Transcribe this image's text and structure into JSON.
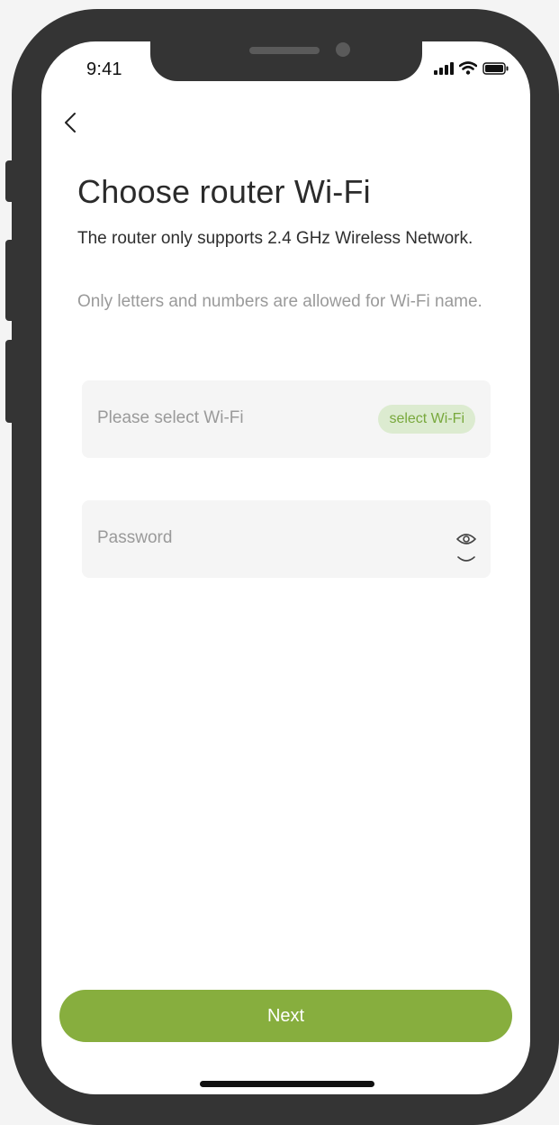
{
  "status_bar": {
    "time": "9:41"
  },
  "header": {
    "back_icon": "chevron-left-icon",
    "title": "Choose router Wi-Fi",
    "subtitle": "The router only supports 2.4 GHz Wireless Network.",
    "hint": "Only letters and numbers are allowed for Wi-Fi name."
  },
  "wifi_field": {
    "placeholder": "Please select Wi-Fi",
    "select_label": "select Wi-Fi"
  },
  "password_field": {
    "placeholder": "Password",
    "toggle_icon": "eye-icon"
  },
  "footer": {
    "next_label": "Next"
  },
  "colors": {
    "accent": "#87ae3e",
    "chip_bg": "#dcebd0",
    "chip_text": "#78a83c",
    "frame": "#343434",
    "field_bg": "#f5f5f5"
  }
}
